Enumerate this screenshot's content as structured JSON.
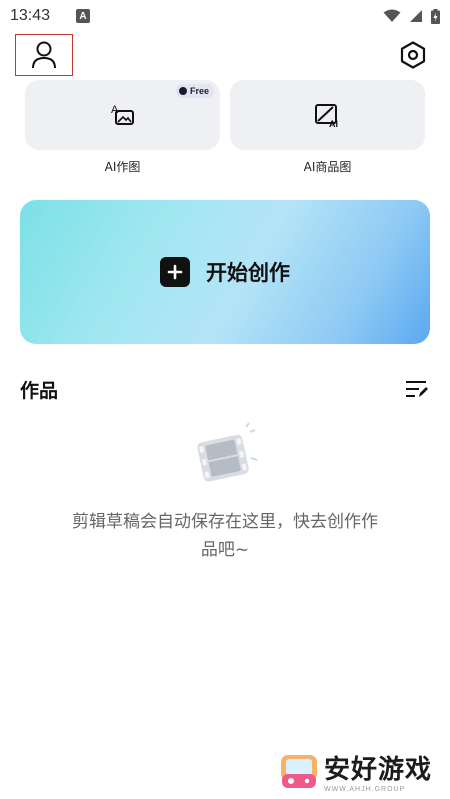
{
  "status_bar": {
    "time": "13:43",
    "notification_letter": "A"
  },
  "tools": [
    {
      "label": "AI作图",
      "badge": "Free"
    },
    {
      "label": "AI商品图"
    }
  ],
  "create": {
    "label": "开始创作"
  },
  "works": {
    "title": "作品"
  },
  "empty": {
    "message": "剪辑草稿会自动保存在这里，快去创作作品吧~"
  },
  "watermark": {
    "title": "安好游戏",
    "subtitle": "WWW.AHJH.GROUP"
  },
  "colors": {
    "accent_gradient_start": "#7ce0e6",
    "accent_gradient_end": "#5aa9f0",
    "card_bg": "#eef0f3",
    "highlight_border": "#c0392b"
  }
}
